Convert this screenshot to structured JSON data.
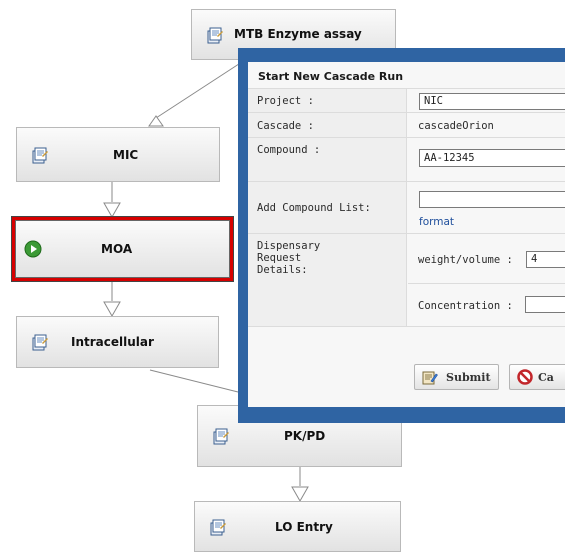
{
  "workflow": {
    "nodes": {
      "mtb": "MTB Enzyme assay",
      "mic": "MIC",
      "moa": "MOA",
      "intracellular": "Intracellular",
      "pkpd": "PK/PD",
      "lo": "LO Entry"
    },
    "colors": {
      "selected_border": "#d60000",
      "node_fill_top": "#fbfbfb",
      "node_fill_bottom": "#e2e2e2"
    }
  },
  "dialog": {
    "title": "Start New Cascade Run",
    "frame_color": "#2f64a3",
    "fields": {
      "project_label": "Project :",
      "project_value": "NIC",
      "cascade_label": "Cascade :",
      "cascade_value": "cascadeOrion",
      "compound_label": "Compound :",
      "compound_value": "AA-12345",
      "compound_list_label": "Add Compound List:",
      "compound_list_value": "",
      "format_link": "format",
      "dispensary_label": "Dispensary Request Details:",
      "weight_volume_label": "weight/volume :",
      "weight_volume_value": "4",
      "concentration_label": "Concentration  :",
      "concentration_value": ""
    },
    "buttons": {
      "submit": "Submit",
      "cancel": "Ca"
    }
  }
}
